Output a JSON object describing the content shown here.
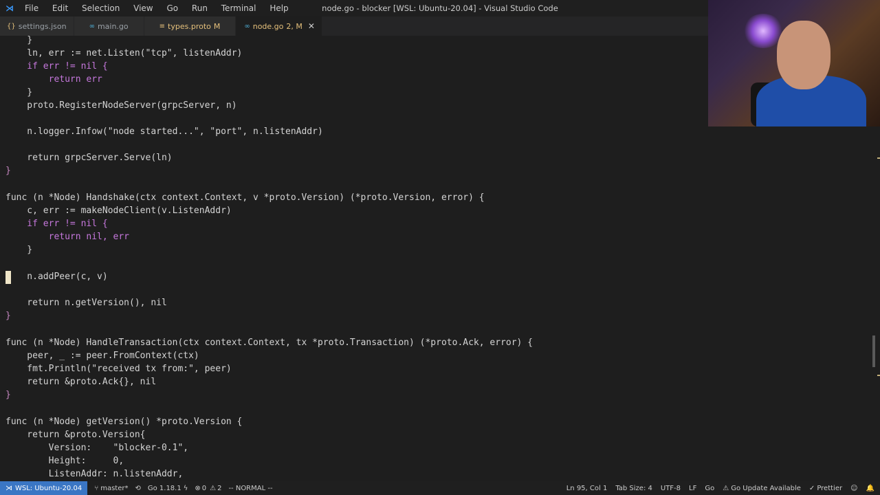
{
  "window": {
    "title": "node.go - blocker [WSL: Ubuntu-20.04] - Visual Studio Code",
    "menu": [
      "File",
      "Edit",
      "Selection",
      "View",
      "Go",
      "Run",
      "Terminal",
      "Help"
    ]
  },
  "tabs": [
    {
      "name": "settings.json",
      "icon": "{}",
      "modified": "",
      "active": false
    },
    {
      "name": "main.go",
      "icon": "∞",
      "modified": "",
      "active": false
    },
    {
      "name": "types.proto",
      "icon": "≡",
      "modified": "M",
      "active": false
    },
    {
      "name": "node.go",
      "icon": "∞",
      "modified": "2, M",
      "active": true
    }
  ],
  "code": [
    "    }",
    "    ln, err := net.Listen(\"tcp\", listenAddr)",
    "    if err != nil {",
    "        return err",
    "    }",
    "    proto.RegisterNodeServer(grpcServer, n)",
    "",
    "    n.logger.Infow(\"node started...\", \"port\", n.listenAddr)",
    "",
    "    return grpcServer.Serve(ln)",
    "}",
    "",
    "func (n *Node) Handshake(ctx context.Context, v *proto.Version) (*proto.Version, error) {",
    "    c, err := makeNodeClient(v.ListenAddr)",
    "    if err != nil {",
    "        return nil, err",
    "    }",
    "",
    "    n.addPeer(c, v)",
    "",
    "    return n.getVersion(), nil",
    "}",
    "",
    "func (n *Node) HandleTransaction(ctx context.Context, tx *proto.Transaction) (*proto.Ack, error) {",
    "    peer, _ := peer.FromContext(ctx)",
    "    fmt.Println(\"received tx from:\", peer)",
    "    return &proto.Ack{}, nil",
    "}",
    "",
    "func (n *Node) getVersion() *proto.Version {",
    "    return &proto.Version{",
    "        Version:    \"blocker-0.1\",",
    "        Height:     0,",
    "        ListenAddr: n.listenAddr,"
  ],
  "status": {
    "remote": "WSL: Ubuntu-20.04",
    "branch": "master*",
    "go_version": "Go 1.18.1",
    "problems": "0",
    "warnings": "2",
    "mode": "-- NORMAL --",
    "position": "Ln 95, Col 1",
    "tab_size": "Tab Size: 4",
    "encoding": "UTF-8",
    "eol": "LF",
    "language": "Go",
    "update": "Go Update Available",
    "formatter": "Prettier"
  },
  "colors": {
    "accent": "#3a76c4",
    "keyword": "#c678dd",
    "string": "#c3e88d"
  }
}
